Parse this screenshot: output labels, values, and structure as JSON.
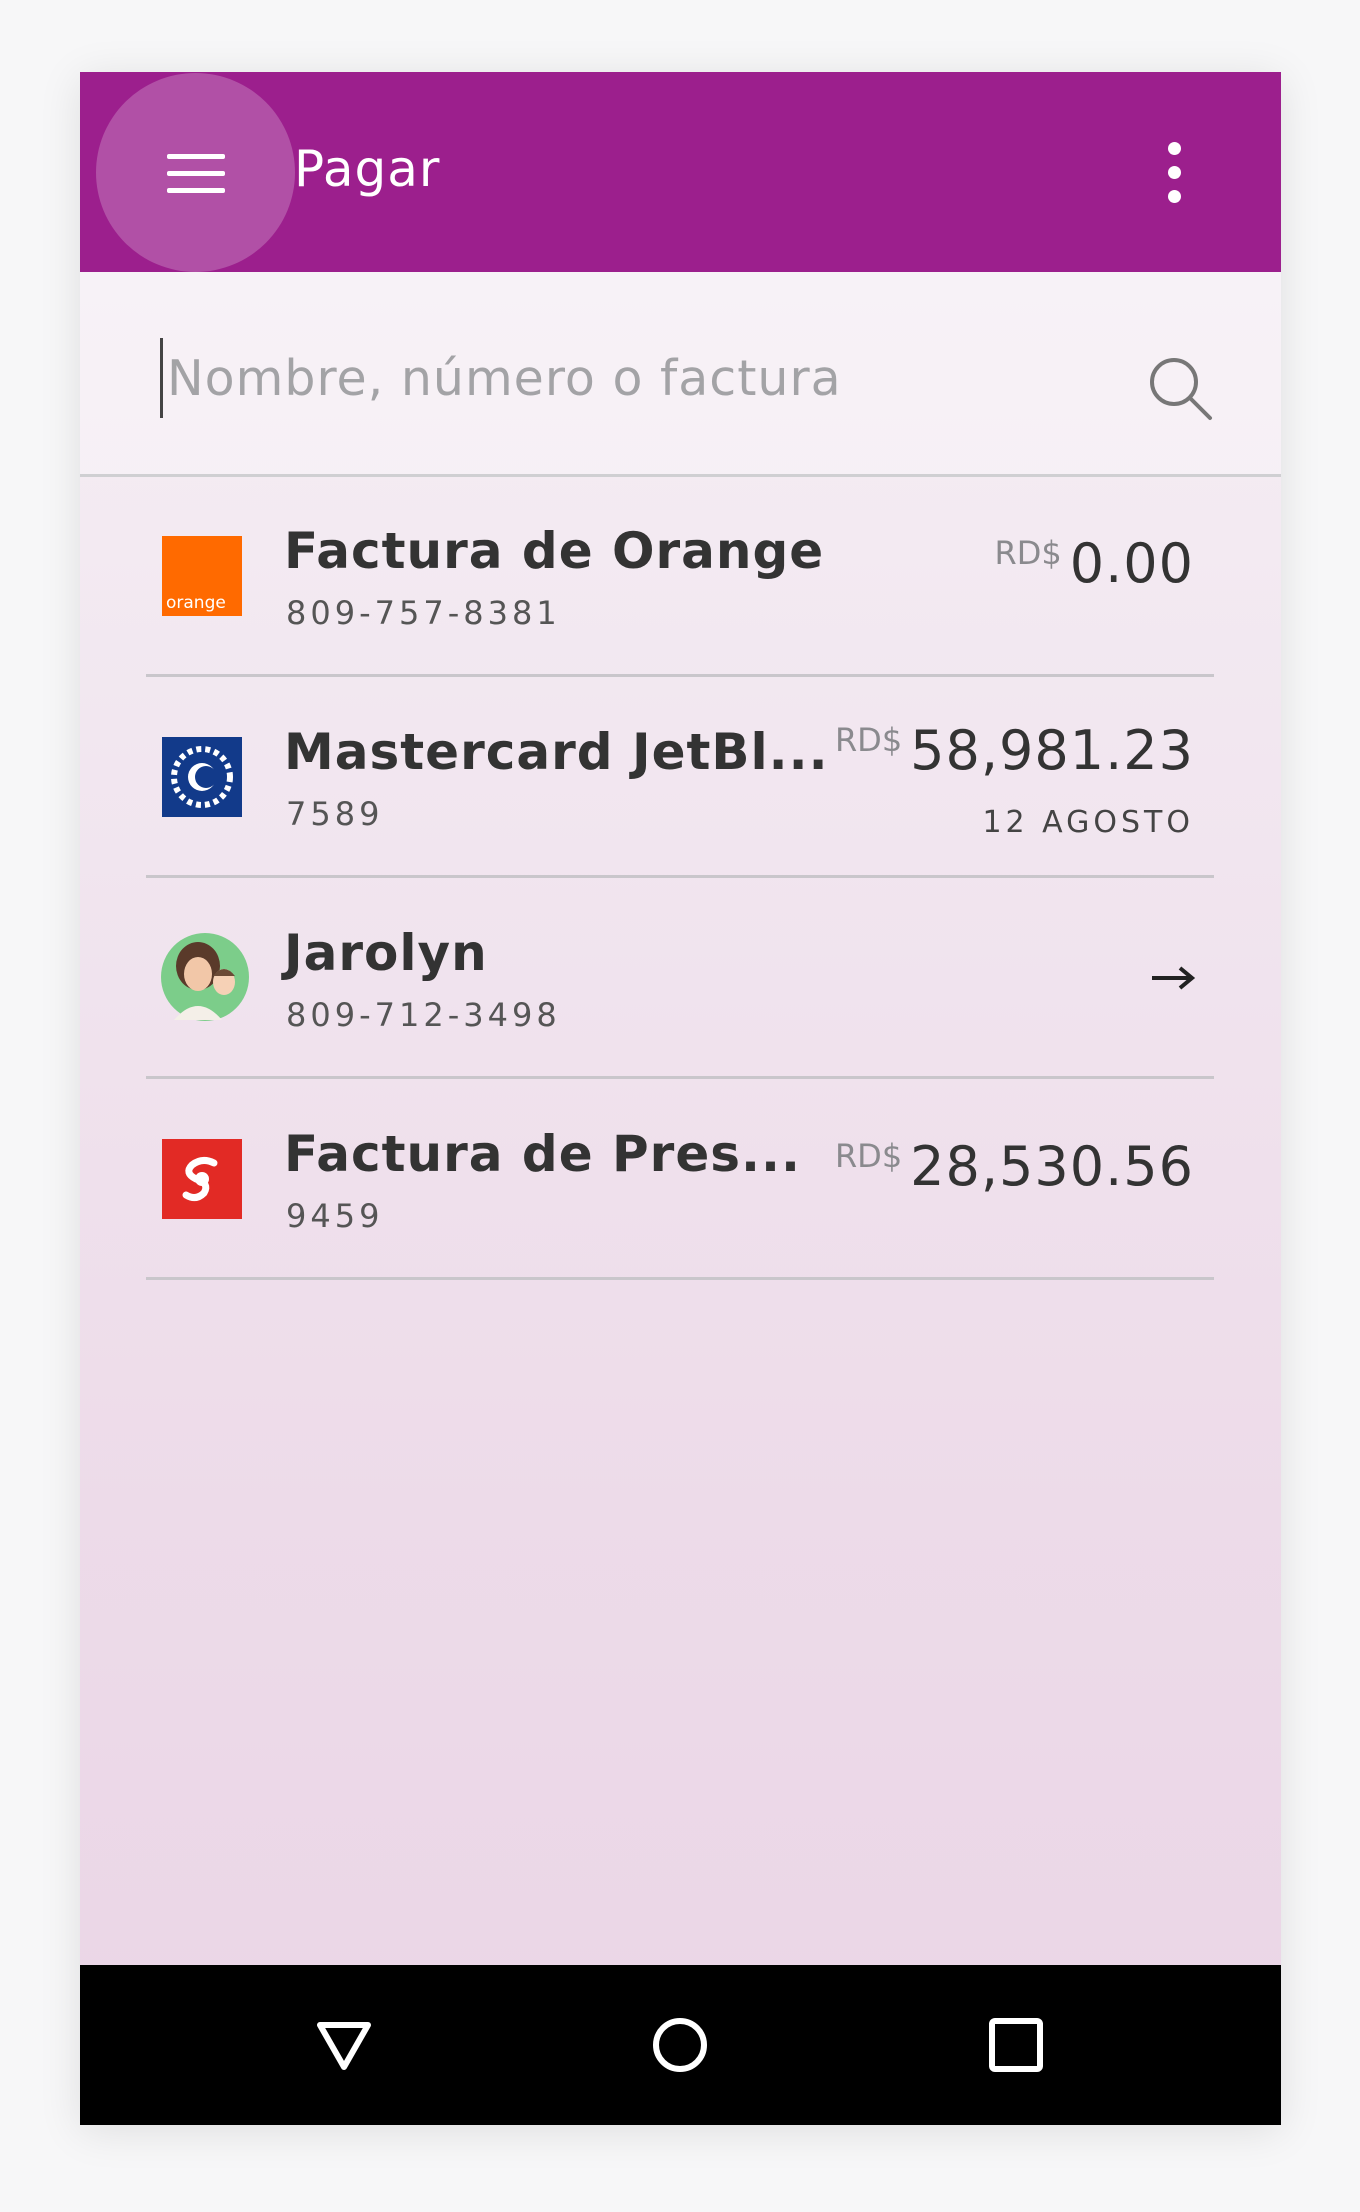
{
  "appbar": {
    "title": "Pagar",
    "color": "#9c1f8d",
    "menu_icon": "hamburger-menu-icon",
    "more_icon": "more-vertical-icon"
  },
  "search": {
    "placeholder": "Nombre, número o factura",
    "icon": "search-icon"
  },
  "items": [
    {
      "title": "Factura de Orange",
      "subtitle": "809-757-8381",
      "currency": "RD$",
      "amount": "0.00",
      "logo": "orange-logo",
      "logo_text": "orange"
    },
    {
      "title": "Mastercard JetBl...",
      "subtitle": "7589",
      "currency": "RD$",
      "amount": "58,981.23",
      "date": "12 AGOSTO",
      "logo": "bank-sun-logo"
    },
    {
      "title": "Jarolyn",
      "subtitle": "809-712-3498",
      "logo": "contact-avatar",
      "action_icon": "arrow-right-icon"
    },
    {
      "title": "Factura de Pres...",
      "subtitle": "9459",
      "currency": "RD$",
      "amount": "28,530.56",
      "logo": "scotiabank-logo"
    }
  ],
  "navbar": {
    "back_icon": "nav-back-icon",
    "home_icon": "nav-home-icon",
    "recents_icon": "nav-recents-icon"
  }
}
